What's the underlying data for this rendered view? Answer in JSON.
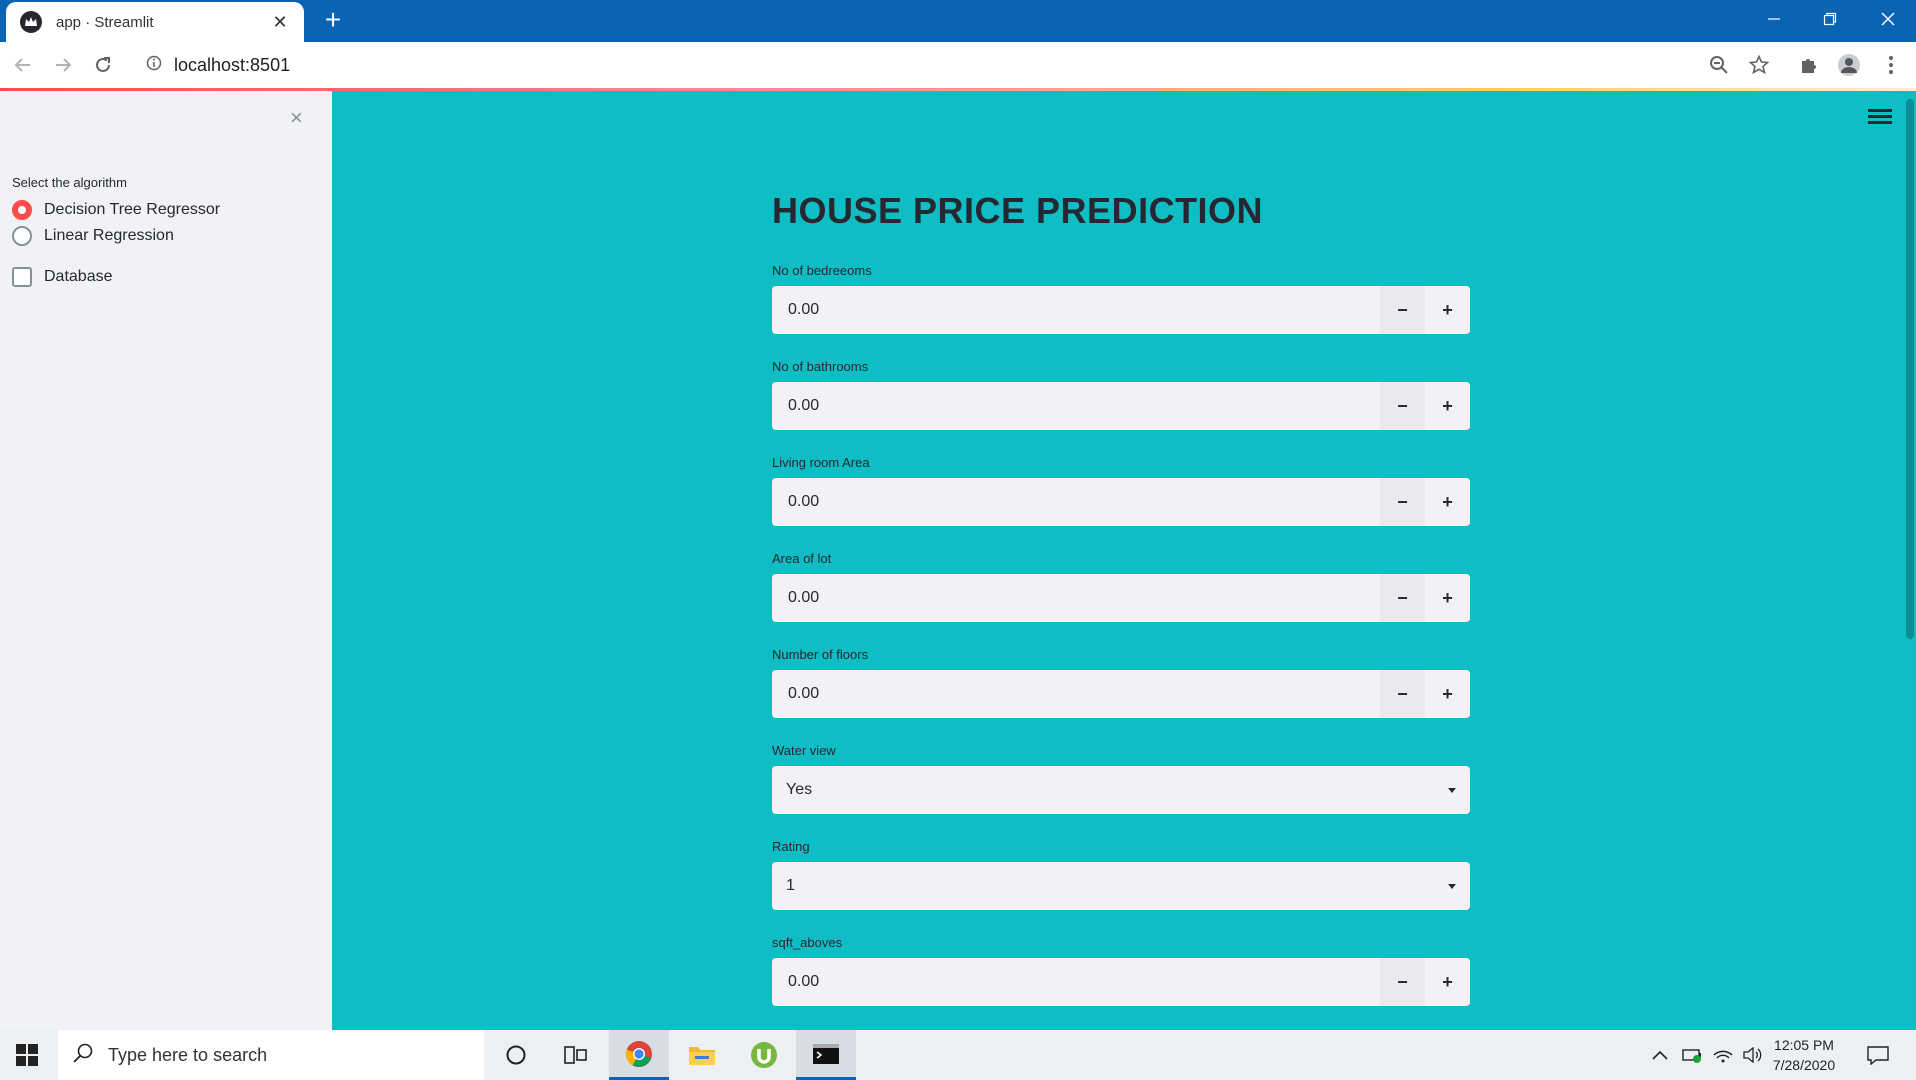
{
  "browser": {
    "tab_title": "app · Streamlit",
    "url": "localhost:8501"
  },
  "sidebar": {
    "close_label": "×",
    "algorithm_label": "Select the algorithm",
    "algorithms": [
      {
        "label": "Decision Tree Regressor",
        "selected": true
      },
      {
        "label": "Linear Regression",
        "selected": false
      }
    ],
    "database_label": "Database",
    "database_checked": false
  },
  "main": {
    "title": "HOUSE PRICE PREDICTION",
    "fields": [
      {
        "label": "No of bedreeoms",
        "type": "number",
        "value": "0.00"
      },
      {
        "label": "No of bathrooms",
        "type": "number",
        "value": "0.00"
      },
      {
        "label": "Living room Area",
        "type": "number",
        "value": "0.00"
      },
      {
        "label": "Area of lot",
        "type": "number",
        "value": "0.00"
      },
      {
        "label": "Number of floors",
        "type": "number",
        "value": "0.00"
      },
      {
        "label": "Water view",
        "type": "select",
        "value": "Yes"
      },
      {
        "label": "Rating",
        "type": "select",
        "value": "1"
      },
      {
        "label": "sqft_aboves",
        "type": "number",
        "value": "0.00"
      }
    ],
    "minus_label": "−",
    "plus_label": "+"
  },
  "taskbar": {
    "search_placeholder": "Type here to search",
    "time": "12:05 PM",
    "date": "7/28/2020"
  },
  "colors": {
    "main_bg": "#0fbec4",
    "sidebar_bg": "#f0f2f6",
    "accent": "#ff4b4b",
    "chrome_blue": "#0b63b4"
  }
}
